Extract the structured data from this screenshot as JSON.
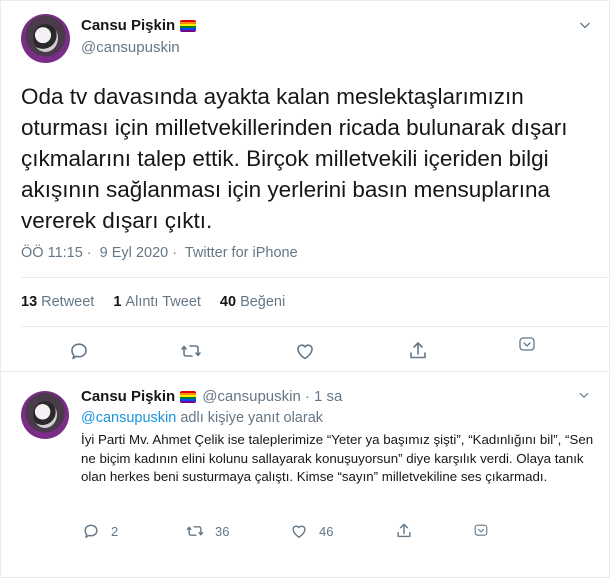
{
  "tweet": {
    "display_name": "Cansu Pişkin",
    "handle": "@cansupuskin",
    "text": "Oda tv davasında ayakta kalan meslektaşlarımızın oturması için milletvekillerinden ricada bulunarak dışarı çıkmalarını talep ettik. Birçok milletvekili içeriden bilgi akışının sağlanması için yerlerini basın mensuplarına vererek dışarı çıktı.",
    "time": "ÖÖ 11:15",
    "separator": "·",
    "date": "9 Eyl 2020",
    "source": "Twitter for iPhone",
    "stats": {
      "retweets_count": "13",
      "retweets_label": "Retweet",
      "quotes_count": "1",
      "quotes_label": "Alıntı Tweet",
      "likes_count": "40",
      "likes_label": "Beğeni"
    }
  },
  "reply": {
    "display_name": "Cansu Pişkin",
    "handle": "@cansupuskin",
    "time": "· 1 sa",
    "reply_to_handle": "@cansupuskin",
    "reply_to_suffix": " adlı kişiye yanıt olarak",
    "text": "İyi Parti Mv. Ahmet Çelik ise taleplerimize “Yeter ya başımız şişti”, “Kadınlığını bil”, “Sen ne biçim kadının elini kolunu sallayarak konuşuyorsun” diye karşılık verdi. Olaya tanık olan herkes beni susturmaya çalıştı. Kimse “sayın” milletvekiline ses çıkarmadı.",
    "reply_count": "2",
    "retweet_count": "36",
    "like_count": "46"
  },
  "colors": {
    "text": "#14171a",
    "muted": "#657786",
    "link": "#1b95e0",
    "border": "#e6ecf0"
  },
  "icons": [
    "chevron-down-icon",
    "reply-icon",
    "retweet-icon",
    "like-icon",
    "share-icon",
    "rainbow-flag-icon"
  ]
}
